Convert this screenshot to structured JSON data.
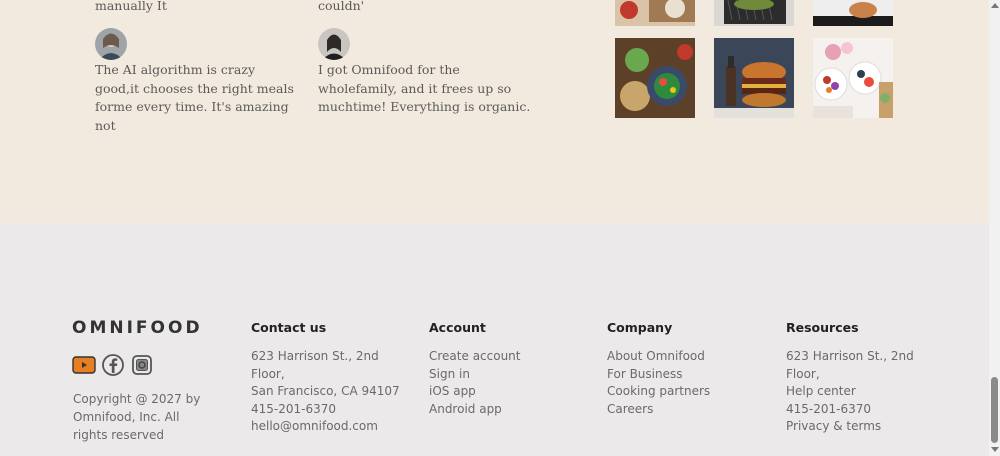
{
  "testimonials": {
    "left": {
      "fragment": "manually It",
      "quote": "The AI algorithm is crazy good,it chooses the right meals forme every time. It's amazing not"
    },
    "right": {
      "fragment": "couldn'",
      "quote": "I got Omnifood for the wholefamily, and it frees up so muchtime! Everything is organic."
    }
  },
  "gallery": {
    "images": [
      "food-grilled-dish",
      "food-bowls",
      "food-salad",
      "food-burger",
      "food-fruit-bowls",
      "food-noodles",
      "food-avocado-toast"
    ]
  },
  "footer": {
    "logo": "OMNIFOOD",
    "social": [
      "youtube-icon",
      "facebook-icon",
      "instagram-icon"
    ],
    "copyright": "Copyright @ 2027 by Omnifood, Inc. All rights reserved",
    "columns": [
      {
        "title": "Contact us",
        "items": [
          "623 Harrison St., 2nd",
          "Floor,",
          "San Francisco, CA 94107",
          "415-201-6370",
          "hello@omnifood.com"
        ]
      },
      {
        "title": "Account",
        "items": [
          "Create account",
          "Sign in",
          "iOS app",
          "Android app"
        ]
      },
      {
        "title": "Company",
        "items": [
          "About Omnifood",
          "For Business",
          "Cooking partners",
          "Careers"
        ]
      },
      {
        "title": "Resources",
        "items": [
          "623 Harrison St., 2nd",
          "Floor,",
          "Help center",
          "415-201-6370",
          "Privacy & terms"
        ]
      }
    ]
  },
  "colors": {
    "testimonial_bg": "#f3eadf",
    "footer_bg": "#ebe9e9",
    "accent": "#e67e22"
  }
}
